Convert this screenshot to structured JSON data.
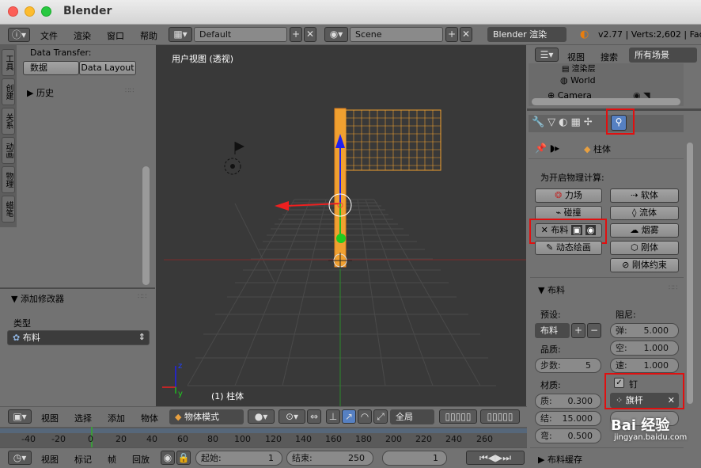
{
  "window": {
    "title": "Blender"
  },
  "menubar": {
    "items": [
      "文件",
      "渲染",
      "窗口",
      "帮助"
    ],
    "layout": "Default",
    "scene": "Scene",
    "engine": "Blender 渲染",
    "stats": "v2.77 | Verts:2,602 | Fac"
  },
  "left": {
    "tabs": [
      "工具",
      "创建",
      "关系",
      "动画",
      "物理",
      "蜡笔"
    ],
    "data_transfer_label": "Data Transfer:",
    "data_btn": "数据",
    "data_layout_btn": "Data Layout",
    "history": "历史",
    "add_modifier": "添加修改器",
    "type_label": "类型",
    "type_value": "布料"
  },
  "viewport": {
    "view_label": "用户视图 (透视)",
    "object_label": "(1) 柱体",
    "header": {
      "view": "视图",
      "select": "选择",
      "add": "添加",
      "object": "物体",
      "mode": "物体模式",
      "global": "全局"
    }
  },
  "outliner": {
    "view": "视图",
    "search": "搜索",
    "scenes": "所有场景",
    "items": [
      "渲染层",
      "World",
      "Camera"
    ]
  },
  "properties": {
    "object": "柱体",
    "enable_physics": "为开启物理计算:",
    "buttons_left": [
      "力场",
      "碰撞",
      "布料",
      "动态绘画"
    ],
    "buttons_right": [
      "软体",
      "流体",
      "烟雾",
      "刚体",
      "刚体约束"
    ],
    "cloth_section": "布料",
    "preset_label": "预设:",
    "preset_value": "布料",
    "quality_label": "品质:",
    "steps": "步数:",
    "steps_value": "5",
    "material_label": "材质:",
    "mass": "质:",
    "mass_value": "0.300",
    "struct": "结:",
    "struct_value": "15.000",
    "bend": "弯:",
    "bend_value": "0.500",
    "damping_label": "阻尼:",
    "spring": "弹:",
    "spring_value": "5.000",
    "air": "空:",
    "air_value": "1.000",
    "vel": "速:",
    "vel_value": "1.000",
    "pin_label": "钉",
    "pin_group": "旗杆",
    "cache_section": "布料缓存"
  },
  "timeline": {
    "ticks": [
      "-40",
      "-20",
      "0",
      "20",
      "40",
      "60",
      "80",
      "100",
      "120",
      "140",
      "160",
      "180",
      "200",
      "220",
      "240",
      "260"
    ],
    "view": "视图",
    "marker": "标记",
    "frame": "帧",
    "playback": "回放",
    "start_label": "起始:",
    "start_value": "1",
    "end_label": "结束:",
    "end_value": "250",
    "current": "1"
  },
  "watermark": "Bai 经验",
  "watermark_url": "jingyan.baidu.com"
}
